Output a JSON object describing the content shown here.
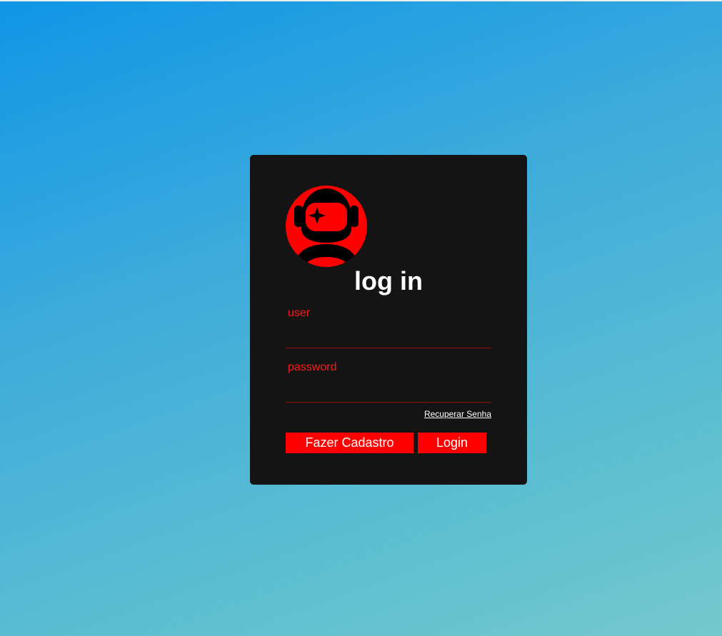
{
  "colors": {
    "card_background": "#141414",
    "accent": "#ff0000",
    "label": "#ff1a1a",
    "title": "#ffffff"
  },
  "login": {
    "avatar_icon": "astronaut-icon",
    "title": "log in",
    "user_label": "user",
    "user_value": "",
    "password_label": "password",
    "password_value": "",
    "recover_link": "Recuperar Senha",
    "signup_button": "Fazer Cadastro",
    "login_button": "Login"
  }
}
